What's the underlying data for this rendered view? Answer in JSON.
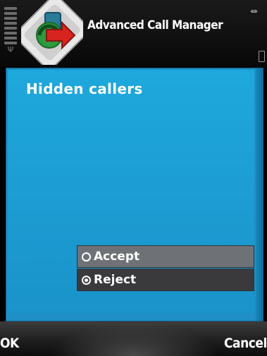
{
  "titlebar": {
    "title": "Advanced Call Manager",
    "app_icon": "phone-redirect-icon",
    "signal_icon": "signal-strength-icon",
    "battery_icon": "battery-icon",
    "charging_icon": "charger-plug-icon"
  },
  "dialog": {
    "title": "Hidden callers",
    "options": [
      {
        "label": "Accept",
        "selected": false
      },
      {
        "label": "Reject",
        "selected": true
      }
    ]
  },
  "softkeys": {
    "left": "OK",
    "right": "Cancel"
  },
  "colors": {
    "dialog_blue": "#1ea8dc",
    "selected_row": "#3a3a3c",
    "unselected_row": "#6e7175"
  }
}
